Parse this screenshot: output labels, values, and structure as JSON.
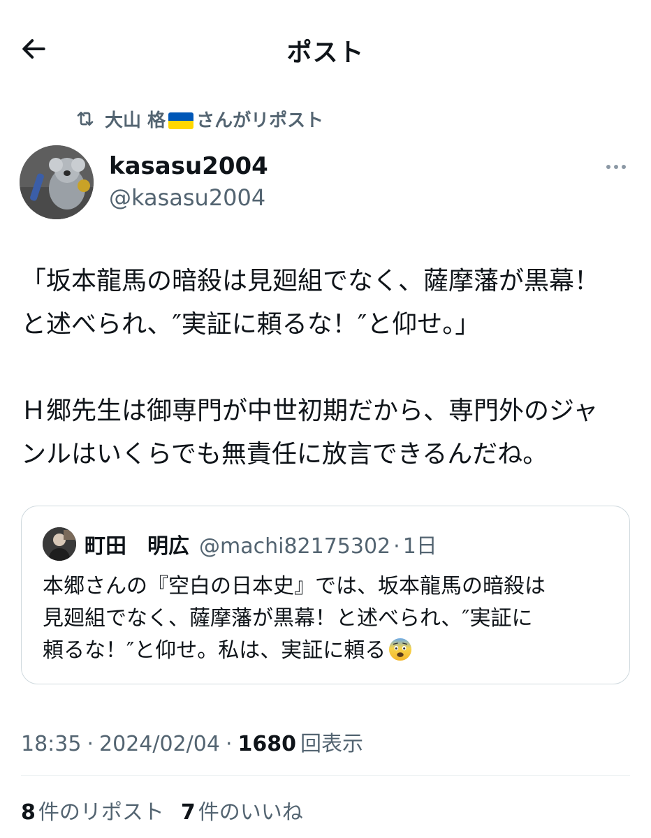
{
  "header": {
    "title": "ポスト"
  },
  "repost": {
    "user": "大山 格",
    "suffix": "さんがリポスト"
  },
  "author": {
    "name": "kasasu2004",
    "handle": "@kasasu2004"
  },
  "tweet": {
    "lines": [
      "「坂本龍馬の暗殺は見廻組でなく、薩摩藩が黒幕！",
      "と述べられ、″実証に頼るな！″と仰せ。」",
      "",
      "Ｈ郷先生は御専門が中世初期だから、専門外のジャ",
      "ンルはいくらでも無責任に放言できるんだね。"
    ]
  },
  "quote": {
    "name": "町田　明広",
    "handle": "@machi82175302",
    "separator": "·",
    "time": "1日",
    "lines": [
      "本郷さんの『空白の日本史』では、坂本龍馬の暗殺は",
      "見廻組でなく、薩摩藩が黒幕！と述べられ、″実証に",
      "頼るな！″と仰せ。私は、実証に頼る"
    ]
  },
  "meta": {
    "time": "18:35",
    "dot1": "·",
    "date": "2024/02/04",
    "dot2": "·",
    "views": "1680",
    "views_label": "回表示"
  },
  "stats": {
    "reposts_count": "8",
    "reposts_label": "件のリポスト",
    "likes_count": "7",
    "likes_label": "件のいいね"
  },
  "icons": {
    "back": "arrow-left-icon",
    "repost": "repost-icon",
    "more": "more-icon",
    "flag": "ukraine-flag-icon",
    "emoji": "fearful-face-emoji"
  },
  "colors": {
    "text": "#0f1419",
    "secondary": "#536471",
    "border": "#cfd9de",
    "flag_blue": "#0057b7",
    "flag_yellow": "#ffd700"
  }
}
